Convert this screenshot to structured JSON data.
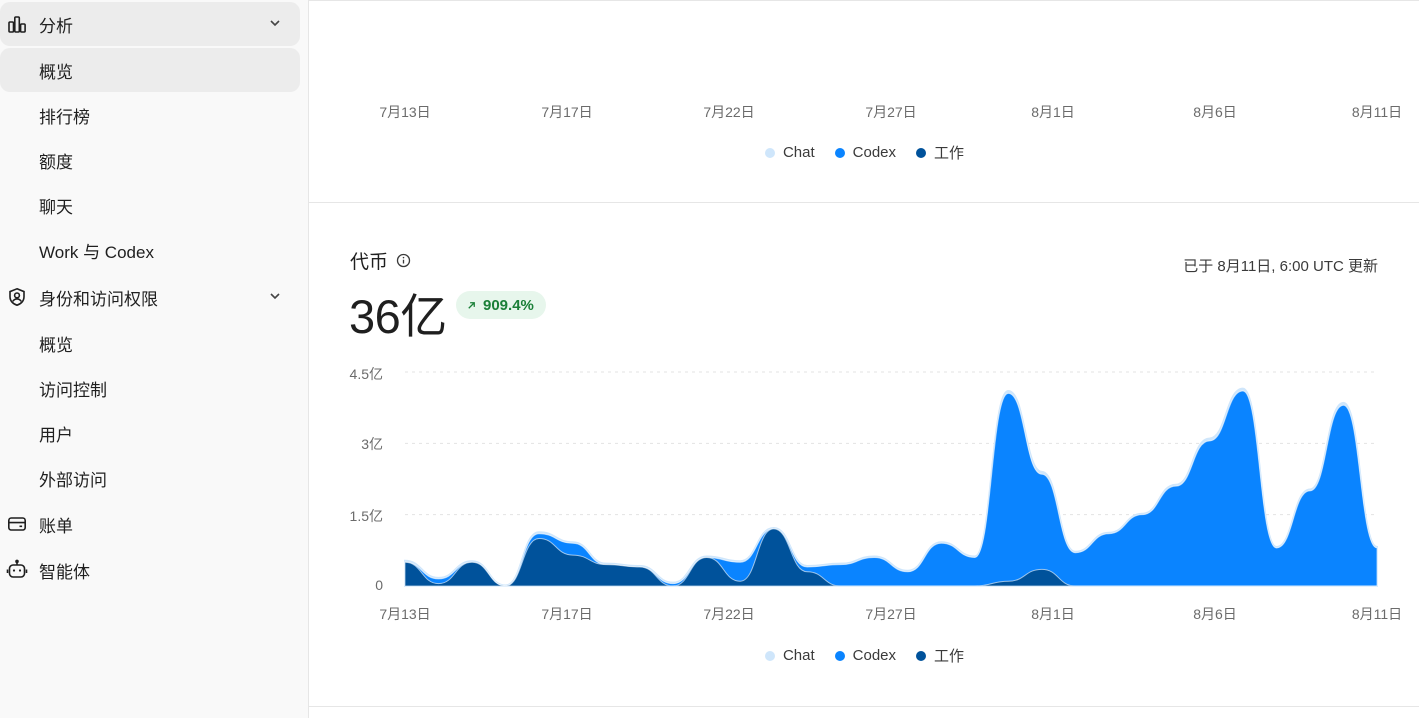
{
  "sidebar": {
    "analytics": {
      "label": "分析",
      "icon": "bar-chart-icon"
    },
    "analytics_items": [
      "概览",
      "排行榜",
      "额度",
      "聊天",
      "Work 与 Codex"
    ],
    "identity": {
      "label": "身份和访问权限",
      "icon": "user-shield-icon"
    },
    "identity_items": [
      "概览",
      "访问控制",
      "用户",
      "外部访问"
    ],
    "billing": {
      "label": "账单",
      "icon": "wallet-icon"
    },
    "agents": {
      "label": "智能体",
      "icon": "robot-icon"
    }
  },
  "legend": [
    {
      "name": "Chat",
      "color": "#cfe6fb"
    },
    {
      "name": "Codex",
      "color": "#0a84ff"
    },
    {
      "name": "工作",
      "color": "#00529b"
    }
  ],
  "top_chart": {
    "x_ticks": [
      "7月13日",
      "7月17日",
      "7月22日",
      "7月27日",
      "8月1日",
      "8月6日",
      "8月11日"
    ]
  },
  "tokens_card": {
    "title": "代币",
    "value": "36亿",
    "change": "909.4%",
    "updated": "已于 8月11日, 6:00 UTC 更新"
  },
  "chart_data": {
    "type": "area",
    "title": "代币",
    "x_ticks": [
      "7月13日",
      "7月17日",
      "7月22日",
      "7月27日",
      "8月1日",
      "8月6日",
      "8月11日"
    ],
    "y_ticks": [
      "0",
      "1.5亿",
      "3亿",
      "4.5亿"
    ],
    "ylim": [
      0,
      4.5
    ],
    "y_unit": "亿",
    "x": [
      "7/13",
      "7/14",
      "7/15",
      "7/16",
      "7/17",
      "7/18",
      "7/19",
      "7/20",
      "7/21",
      "7/22",
      "7/23",
      "7/24",
      "7/25",
      "7/26",
      "7/27",
      "7/28",
      "7/29",
      "7/30",
      "7/31",
      "8/1",
      "8/2",
      "8/3",
      "8/4",
      "8/5",
      "8/6",
      "8/7",
      "8/8",
      "8/9",
      "8/10",
      "8/11"
    ],
    "stacked": true,
    "series": [
      {
        "name": "工作",
        "values": [
          0.5,
          0.05,
          0.5,
          0.0,
          1.0,
          0.65,
          0.45,
          0.4,
          0.0,
          0.6,
          0.1,
          1.2,
          0.3,
          0.0,
          0.0,
          0.0,
          0.0,
          0.0,
          0.1,
          0.35,
          0.0,
          0.0,
          0.0,
          0.0,
          0.0,
          0.0,
          0.0,
          0.0,
          0.0,
          0.0
        ]
      },
      {
        "name": "Codex",
        "values": [
          0.0,
          0.1,
          0.0,
          0.0,
          0.1,
          0.25,
          0.0,
          0.0,
          0.05,
          0.0,
          0.4,
          0.0,
          0.1,
          0.45,
          0.6,
          0.3,
          0.9,
          0.6,
          3.95,
          2.0,
          0.7,
          1.1,
          1.5,
          2.1,
          3.05,
          4.1,
          0.8,
          2.0,
          3.8,
          0.8
        ]
      },
      {
        "name": "Chat",
        "values": [
          0.03,
          0.02,
          0.02,
          0.01,
          0.03,
          0.02,
          0.02,
          0.02,
          0.02,
          0.02,
          0.02,
          0.02,
          0.02,
          0.02,
          0.02,
          0.02,
          0.02,
          0.02,
          0.05,
          0.05,
          0.02,
          0.02,
          0.02,
          0.03,
          0.05,
          0.05,
          0.02,
          0.03,
          0.05,
          0.02
        ]
      }
    ]
  }
}
